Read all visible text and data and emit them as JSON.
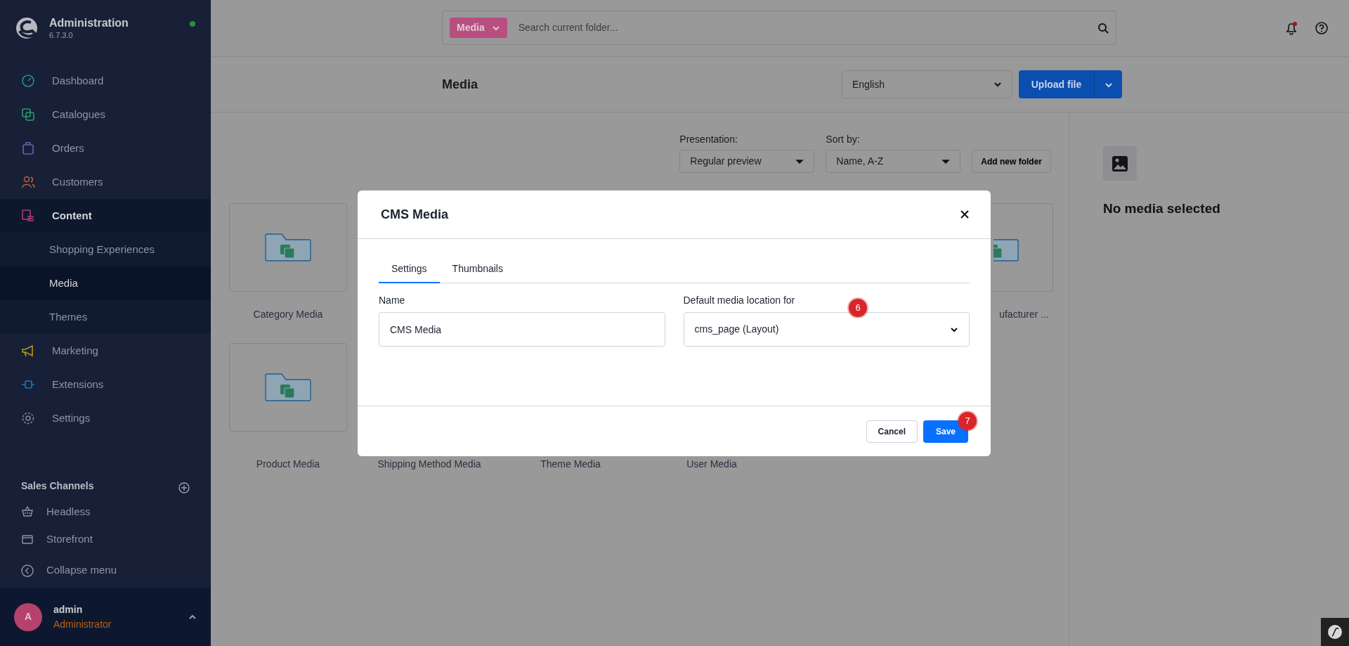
{
  "sidebar": {
    "title": "Administration",
    "version": "6.7.3.0",
    "online": true,
    "nav": [
      {
        "label": "Dashboard",
        "selected": false
      },
      {
        "label": "Catalogues",
        "selected": false
      },
      {
        "label": "Orders",
        "selected": false
      },
      {
        "label": "Customers",
        "selected": false
      },
      {
        "label": "Content",
        "selected": true,
        "expanded": true,
        "children": [
          {
            "label": "Shopping Experiences",
            "selected": false
          },
          {
            "label": "Media",
            "selected": true
          },
          {
            "label": "Themes",
            "selected": false
          }
        ]
      },
      {
        "label": "Marketing",
        "selected": false
      },
      {
        "label": "Extensions",
        "selected": false
      },
      {
        "label": "Settings",
        "selected": false
      }
    ],
    "sales_channels": {
      "title": "Sales Channels",
      "items": [
        {
          "label": "Headless"
        },
        {
          "label": "Storefront"
        }
      ]
    },
    "collapse": "Collapse menu",
    "user": {
      "initial": "A",
      "name": "admin",
      "role": "Administrator"
    }
  },
  "search": {
    "scope": "Media",
    "placeholder": "Search current folder..."
  },
  "header": {
    "title": "Media",
    "language": "English",
    "upload": "Upload file"
  },
  "toolbar": {
    "presentation_label": "Presentation:",
    "presentation": "Regular preview",
    "sort_label": "Sort by:",
    "sort": "Name, A-Z",
    "add_folder": "Add new folder"
  },
  "folders": [
    [
      {
        "kind": "folder",
        "label": "Category Media"
      },
      {
        "kind": "hidden"
      },
      {
        "kind": "hidden"
      },
      {
        "kind": "hidden"
      },
      {
        "kind": "hidden"
      },
      {
        "kind": "folder",
        "label": "ufacturer ..."
      }
    ],
    [
      {
        "kind": "folder",
        "label": "Product Media"
      },
      {
        "kind": "label_only",
        "label": "Shipping Method Media"
      },
      {
        "kind": "label_only",
        "label": "Theme Media"
      },
      {
        "kind": "label_only",
        "label": "User Media"
      }
    ]
  ],
  "detail": {
    "empty": "No media selected"
  },
  "modal": {
    "title": "CMS Media",
    "tabs": [
      {
        "label": "Settings",
        "selected": true
      },
      {
        "label": "Thumbnails",
        "selected": false
      }
    ],
    "name_label": "Name",
    "name_value": "CMS Media",
    "location_label": "Default media location for",
    "location_value": "cms_page (Layout)",
    "cancel": "Cancel",
    "save": "Save"
  },
  "markers": [
    "6",
    "7"
  ]
}
